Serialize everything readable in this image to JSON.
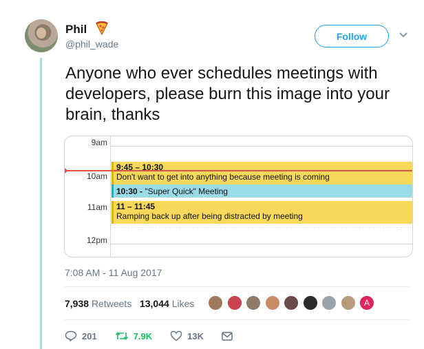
{
  "author": {
    "name": "Phil",
    "handle": "@phil_wade",
    "emoji_icon": "pizza-icon"
  },
  "follow_label": "Follow",
  "tweet_text": "Anyone who ever schedules meetings with developers, please burn this image into your brain, thanks",
  "calendar": {
    "times": [
      "9am",
      "10am",
      "11am",
      "12pm"
    ],
    "events": [
      {
        "time": "9:45 – 10:30",
        "title": "Don't want to get into anything because meeting is coming"
      },
      {
        "time": "10:30 -",
        "title": "\"Super Quick\" Meeting"
      },
      {
        "time": "11 – 11:45",
        "title": "Ramping back up after being distracted by meeting"
      }
    ]
  },
  "timestamp": "7:08 AM - 11 Aug 2017",
  "stats": {
    "retweets": "7,938",
    "retweets_label": "Retweets",
    "likes": "13,044",
    "likes_label": "Likes"
  },
  "liker_last_initial": "A",
  "actions": {
    "replies": "201",
    "retweets": "7.9K",
    "likes": "13K"
  },
  "colors": {
    "accent": "#1da1f2",
    "event_yellow": "#f8d85a",
    "event_blue": "#9bdbe8",
    "now_line": "#e0564a"
  }
}
